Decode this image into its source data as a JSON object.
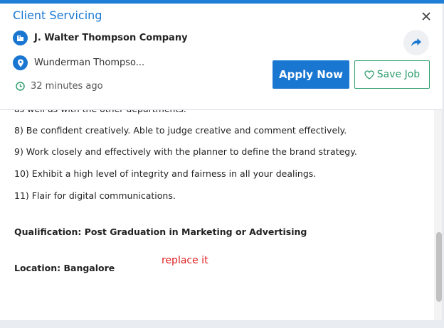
{
  "header": {
    "job_title": "Client Servicing",
    "company": "J. Walter Thompson Company",
    "location": "Wunderman Thompso...",
    "posted": "32 minutes ago",
    "apply_label": "Apply Now",
    "save_label": "Save Job"
  },
  "description": {
    "partial_line": "as well as with the other departments.",
    "items": [
      "8) Be confident creatively. Able to judge creative and comment effectively.",
      "9) Work closely and effectively with the planner to define the brand strategy.",
      "10) Exhibit a high level of integrity and fairness in all your dealings.",
      "11) Flair for digital communications."
    ],
    "qualification": "Qualification: Post Graduation in Marketing or Advertising",
    "location_line": "Location: Bangalore"
  },
  "annotation": "replace it",
  "colors": {
    "accent": "#1a77d1",
    "save_green": "#2f9e6f",
    "annotation_red": "#e02020"
  },
  "icons": {
    "close": "close-icon",
    "company": "building-icon",
    "location": "map-pin-icon",
    "time": "clock-icon",
    "share": "share-arrow-icon",
    "save": "heart-icon"
  }
}
